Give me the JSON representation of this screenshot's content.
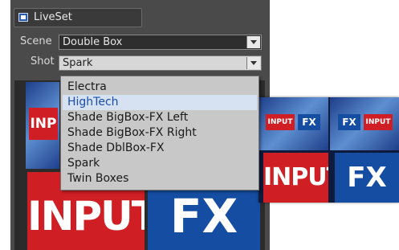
{
  "window": {
    "title": "LiveSet"
  },
  "scene": {
    "label": "Scene",
    "value": "Double Box"
  },
  "shot": {
    "label": "Shot",
    "value": "Spark",
    "options": [
      "Electra",
      "HighTech",
      "Shade BigBox-FX Left",
      "Shade BigBox-FX Right",
      "Shade DblBox-FX",
      "Spark",
      "Twin Boxes"
    ],
    "highlighted": "HighTech"
  },
  "preview": {
    "tile_input": "INPUT",
    "tile_fx": "FX",
    "partial_input": "INP"
  },
  "inset": {
    "badge_input_1": "INPUT",
    "badge_fx_1": "FX",
    "badge_fx_2": "FX",
    "badge_input_2": "INPUT",
    "big_input": "INPUT",
    "big_fx": "FX"
  },
  "colors": {
    "input_red": "#cf1f24",
    "fx_blue": "#154da3",
    "highlight": "#d6e1f2"
  },
  "icons": {
    "window": "liveset-window-icon",
    "dropdown_arrow": "chevron-down-icon"
  }
}
